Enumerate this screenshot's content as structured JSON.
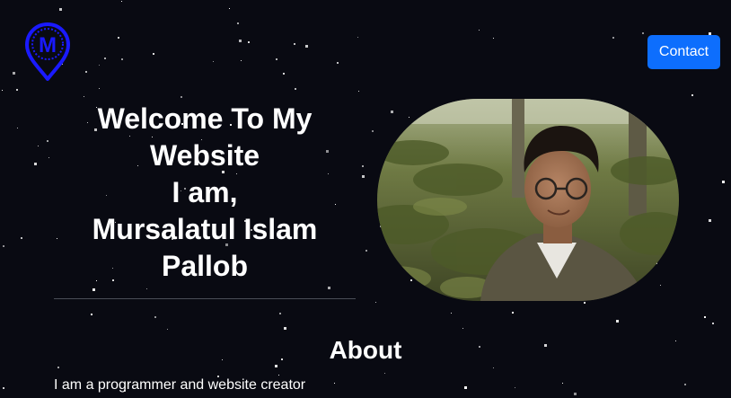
{
  "header": {
    "logo_letter": "M",
    "logo_icon": "map-pin-logo-icon",
    "contact_label": "Contact"
  },
  "hero": {
    "title_lines": [
      "Welcome To My",
      "Website",
      "I am,",
      "Mursalatul Islam",
      "Pallob"
    ]
  },
  "about": {
    "heading": "About",
    "text": "I am a programmer and website creator"
  },
  "colors": {
    "background": "#090a12",
    "accent": "#0d6efd",
    "logo": "#1a1aff",
    "text": "#ffffff"
  }
}
